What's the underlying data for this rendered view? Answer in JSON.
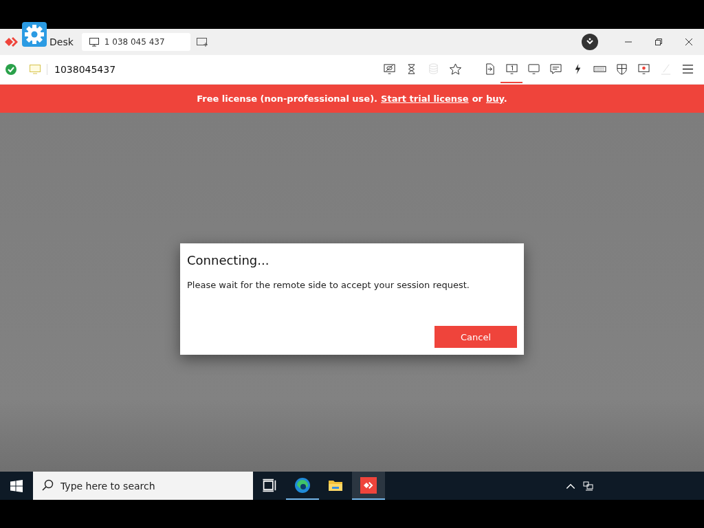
{
  "title_bar": {
    "app_name": "Desk",
    "tab": {
      "label": "1 038 045 437",
      "selected": true
    }
  },
  "toolbar": {
    "connected": true,
    "address": "1038045437",
    "tools": [
      {
        "kind": "privacy",
        "selected": false,
        "disabled": false
      },
      {
        "kind": "hourglass",
        "selected": false,
        "disabled": false
      },
      {
        "kind": "database",
        "selected": false,
        "disabled": true
      },
      {
        "kind": "star",
        "selected": false,
        "disabled": false
      },
      {
        "kind": "file",
        "selected": false,
        "disabled": false
      },
      {
        "kind": "monitor-one",
        "selected": true,
        "disabled": false
      },
      {
        "kind": "monitor",
        "selected": false,
        "disabled": false
      },
      {
        "kind": "chat",
        "selected": false,
        "disabled": false
      },
      {
        "kind": "bolt",
        "selected": false,
        "disabled": false
      },
      {
        "kind": "keyboard",
        "selected": false,
        "disabled": false
      },
      {
        "kind": "shield",
        "selected": false,
        "disabled": false
      },
      {
        "kind": "record",
        "selected": false,
        "disabled": false
      },
      {
        "kind": "pen",
        "selected": false,
        "disabled": true
      },
      {
        "kind": "menu",
        "selected": false,
        "disabled": false
      }
    ]
  },
  "banner": {
    "text": "Free license (non-professional use).",
    "trial_link": "Start trial license",
    "or": "or",
    "buy_link": "buy",
    "end": "."
  },
  "dialog": {
    "title": "Connecting...",
    "message": "Please wait for the remote side to accept your session request.",
    "button": "Cancel"
  },
  "taskbar": {
    "search_placeholder": "Type here to search",
    "apps": [
      {
        "kind": "task-view",
        "selected": false
      },
      {
        "kind": "edge",
        "selected": false
      },
      {
        "kind": "folder",
        "selected": false
      },
      {
        "kind": "anydesk",
        "selected": true
      }
    ]
  }
}
